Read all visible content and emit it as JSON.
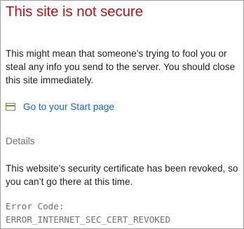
{
  "page": {
    "title": "This site is not secure",
    "message": "This might mean that someone’s trying to fool you or steal any info you send to the server. You should close this site immediately.",
    "start_link": {
      "icon": "start-page-icon",
      "label": "Go to your Start page"
    },
    "details_label": "Details",
    "details_text": "This website’s security certificate has been revoked, so you can’t go there at this time.",
    "error_code_label": "Error Code:",
    "error_code_value": "ERROR_INTERNET_SEC_CERT_REVOKED"
  },
  "colors": {
    "title": "#b4141a",
    "link": "#1e63c8",
    "icon": "#6e9b2b",
    "muted": "#707070"
  }
}
